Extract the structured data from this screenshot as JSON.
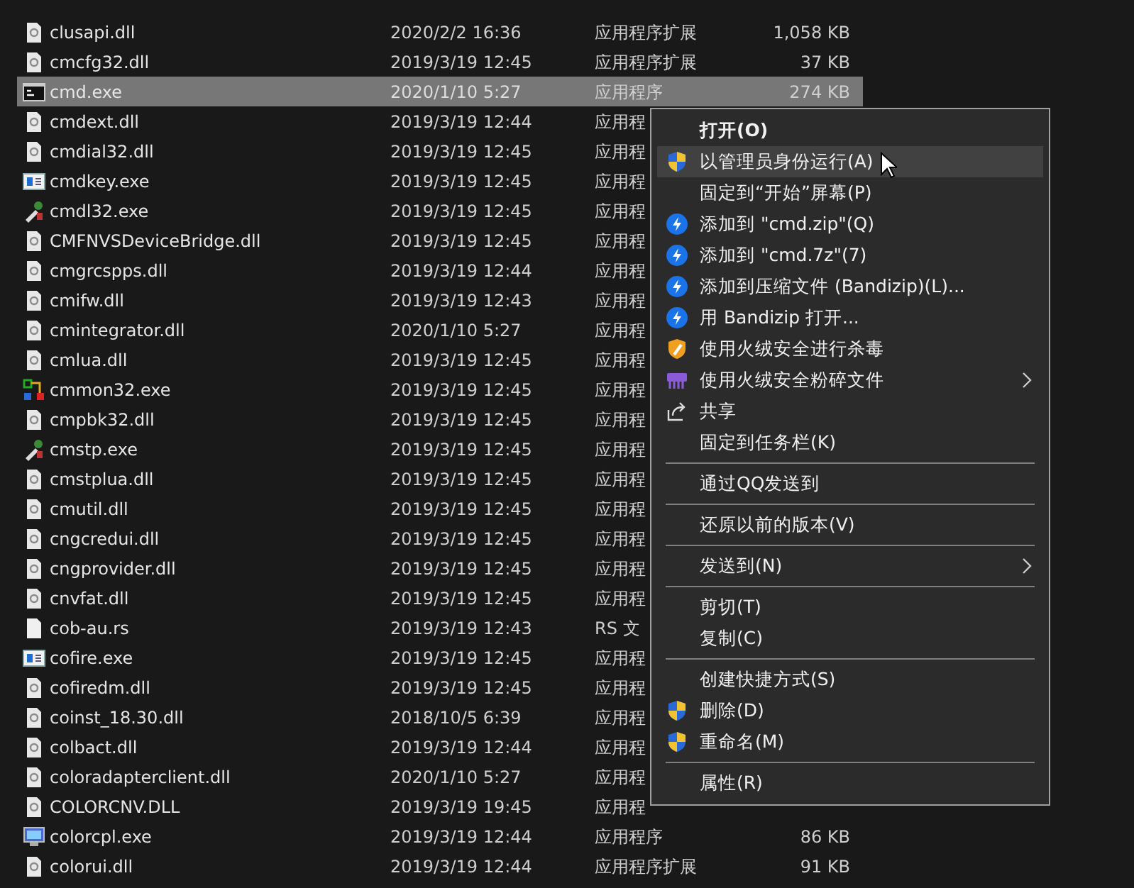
{
  "files": [
    {
      "name": "clusapi.dll",
      "kind": "dll",
      "date": "2020/2/2 16:36",
      "type": "应用程序扩展",
      "size": "1,058 KB",
      "selected": false
    },
    {
      "name": "cmcfg32.dll",
      "kind": "dll",
      "date": "2019/3/19 12:45",
      "type": "应用程序扩展",
      "size": "37 KB",
      "selected": false
    },
    {
      "name": "cmd.exe",
      "kind": "console",
      "date": "2020/1/10 5:27",
      "type": "应用程序",
      "size": "274 KB",
      "selected": true
    },
    {
      "name": "cmdext.dll",
      "kind": "dll",
      "date": "2019/3/19 12:44",
      "type": "应用程",
      "selected": false
    },
    {
      "name": "cmdial32.dll",
      "kind": "dll",
      "date": "2019/3/19 12:45",
      "type": "应用程",
      "selected": false
    },
    {
      "name": "cmdkey.exe",
      "kind": "app",
      "date": "2019/3/19 12:45",
      "type": "应用程",
      "selected": false
    },
    {
      "name": "cmdl32.exe",
      "kind": "tool",
      "date": "2019/3/19 12:45",
      "type": "应用程",
      "selected": false
    },
    {
      "name": "CMFNVSDeviceBridge.dll",
      "kind": "dll",
      "date": "2019/3/19 12:45",
      "type": "应用程",
      "selected": false
    },
    {
      "name": "cmgrcspps.dll",
      "kind": "dll",
      "date": "2019/3/19 12:44",
      "type": "应用程",
      "selected": false
    },
    {
      "name": "cmifw.dll",
      "kind": "dll",
      "date": "2019/3/19 12:43",
      "type": "应用程",
      "selected": false
    },
    {
      "name": "cmintegrator.dll",
      "kind": "dll",
      "date": "2020/1/10 5:27",
      "type": "应用程",
      "selected": false
    },
    {
      "name": "cmlua.dll",
      "kind": "dll",
      "date": "2019/3/19 12:45",
      "type": "应用程",
      "selected": false
    },
    {
      "name": "cmmon32.exe",
      "kind": "network",
      "date": "2019/3/19 12:45",
      "type": "应用程",
      "selected": false
    },
    {
      "name": "cmpbk32.dll",
      "kind": "dll",
      "date": "2019/3/19 12:45",
      "type": "应用程",
      "selected": false
    },
    {
      "name": "cmstp.exe",
      "kind": "tool",
      "date": "2019/3/19 12:45",
      "type": "应用程",
      "selected": false
    },
    {
      "name": "cmstplua.dll",
      "kind": "dll",
      "date": "2019/3/19 12:45",
      "type": "应用程",
      "selected": false
    },
    {
      "name": "cmutil.dll",
      "kind": "dll",
      "date": "2019/3/19 12:45",
      "type": "应用程",
      "selected": false
    },
    {
      "name": "cngcredui.dll",
      "kind": "dll",
      "date": "2019/3/19 12:45",
      "type": "应用程",
      "selected": false
    },
    {
      "name": "cngprovider.dll",
      "kind": "dll",
      "date": "2019/3/19 12:45",
      "type": "应用程",
      "selected": false
    },
    {
      "name": "cnvfat.dll",
      "kind": "dll",
      "date": "2019/3/19 12:45",
      "type": "应用程",
      "selected": false
    },
    {
      "name": "cob-au.rs",
      "kind": "file",
      "date": "2019/3/19 12:43",
      "type": "RS 文",
      "selected": false
    },
    {
      "name": "cofire.exe",
      "kind": "app",
      "date": "2019/3/19 12:45",
      "type": "应用程",
      "selected": false
    },
    {
      "name": "cofiredm.dll",
      "kind": "dll",
      "date": "2019/3/19 12:45",
      "type": "应用程",
      "selected": false
    },
    {
      "name": "coinst_18.30.dll",
      "kind": "dll",
      "date": "2018/10/5 6:39",
      "type": "应用程",
      "selected": false
    },
    {
      "name": "colbact.dll",
      "kind": "dll",
      "date": "2019/3/19 12:44",
      "type": "应用程",
      "selected": false
    },
    {
      "name": "coloradapterclient.dll",
      "kind": "dll",
      "date": "2020/1/10 5:27",
      "type": "应用程",
      "selected": false
    },
    {
      "name": "COLORCNV.DLL",
      "kind": "dll",
      "date": "2019/3/19 19:45",
      "type": "应用程",
      "selected": false
    },
    {
      "name": "colorcpl.exe",
      "kind": "monitor",
      "date": "2019/3/19 12:44",
      "type": "应用程序",
      "size": "86 KB",
      "selected": false
    },
    {
      "name": "colorui.dll",
      "kind": "dll",
      "date": "2019/3/19 12:44",
      "type": "应用程序扩展",
      "size": "91 KB",
      "selected": false
    }
  ],
  "context_menu": {
    "items": [
      {
        "kind": "item",
        "label": "打开(O)",
        "default": true,
        "selected": false
      },
      {
        "kind": "uac",
        "label": "以管理员身份运行(A)",
        "selected": true
      },
      {
        "kind": "item",
        "label": "固定到“开始”屏幕(P)",
        "selected": false
      },
      {
        "kind": "bandizip",
        "label": "添加到 \"cmd.zip\"(Q)",
        "selected": false
      },
      {
        "kind": "bandizip",
        "label": "添加到 \"cmd.7z\"(7)",
        "selected": false
      },
      {
        "kind": "bandizip",
        "label": "添加到压缩文件 (Bandizip)(L)...",
        "selected": false
      },
      {
        "kind": "bandizip",
        "label": "用 Bandizip 打开...",
        "selected": false
      },
      {
        "kind": "shield",
        "label": "使用火绒安全进行杀毒",
        "selected": false
      },
      {
        "kind": "shredder",
        "label": "使用火绒安全粉碎文件",
        "submenu": true,
        "selected": false
      },
      {
        "kind": "share",
        "label": "共享",
        "selected": false
      },
      {
        "kind": "item",
        "label": "固定到任务栏(K)",
        "selected": false
      },
      {
        "kind": "separator"
      },
      {
        "kind": "item",
        "label": "通过QQ发送到",
        "selected": false
      },
      {
        "kind": "separator"
      },
      {
        "kind": "item",
        "label": "还原以前的版本(V)",
        "selected": false
      },
      {
        "kind": "separator"
      },
      {
        "kind": "item",
        "label": "发送到(N)",
        "submenu": true,
        "selected": false
      },
      {
        "kind": "separator"
      },
      {
        "kind": "item",
        "label": "剪切(T)",
        "selected": false
      },
      {
        "kind": "item",
        "label": "复制(C)",
        "selected": false
      },
      {
        "kind": "separator"
      },
      {
        "kind": "item",
        "label": "创建快捷方式(S)",
        "selected": false
      },
      {
        "kind": "uac",
        "label": "删除(D)",
        "selected": false
      },
      {
        "kind": "uac",
        "label": "重命名(M)",
        "selected": false
      },
      {
        "kind": "separator"
      },
      {
        "kind": "item",
        "label": "属性(R)",
        "selected": false
      }
    ]
  }
}
